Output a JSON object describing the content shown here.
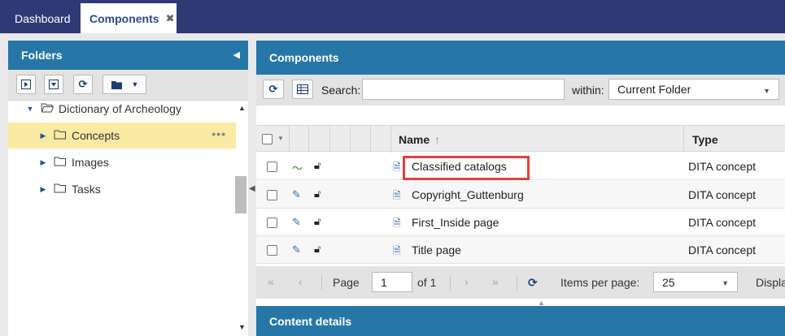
{
  "tabs": [
    {
      "label": "Dashboard"
    },
    {
      "label": "Components",
      "close": "✖"
    }
  ],
  "folders": {
    "title": "Folders",
    "tree": [
      {
        "label": "Dictionary of Archeology"
      },
      {
        "label": "Concepts",
        "more": "•••"
      },
      {
        "label": "Images"
      },
      {
        "label": "Tasks"
      }
    ]
  },
  "components": {
    "title": "Components",
    "search_label": "Search:",
    "search_value": "",
    "within_label": "within:",
    "within_value": "Current Folder",
    "columns": {
      "name": "Name",
      "type": "Type"
    },
    "rows": [
      {
        "name": "Classified catalogs",
        "type": "DITA concept",
        "state": "workflow"
      },
      {
        "name": "Copyright_Guttenburg",
        "type": "DITA concept",
        "state": "edit"
      },
      {
        "name": "First_Inside page",
        "type": "DITA concept",
        "state": "edit"
      },
      {
        "name": "Title page",
        "type": "DITA concept",
        "state": "edit"
      }
    ],
    "pager": {
      "page_label": "Page",
      "page_value": "1",
      "of_label": "of 1",
      "items_per_page_label": "Items per page:",
      "items_per_page_value": "25",
      "display_label": "Displa"
    }
  },
  "details": {
    "title": "Content details"
  },
  "colors": {
    "topbar": "#2f3a75",
    "panel_header": "#2677a8",
    "selected_row": "#fbeaa3",
    "highlight": "#e2403f"
  }
}
